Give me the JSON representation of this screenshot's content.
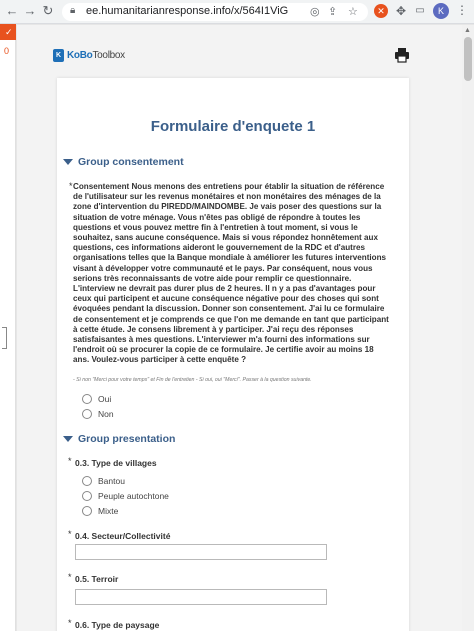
{
  "browser": {
    "url": "ee.humanitarianresponse.info/x/564I1ViG",
    "profile_initial": "K"
  },
  "sidebar": {
    "count": "0"
  },
  "logo": {
    "mark": "K",
    "brand_bold": "KoBo",
    "brand_light": "Toolbox"
  },
  "form": {
    "title": "Formulaire d'enquete 1",
    "groups": [
      {
        "label": "Group consentement"
      },
      {
        "label": "Group presentation"
      }
    ],
    "consent": {
      "required": "*",
      "text": "Consentement Nous menons des entretiens pour établir la situation de référence de l'utilisateur sur les revenus monétaires et non monétaires des ménages de la zone d'intervention du PIREDD/MAINDOMBE. Je vais poser des questions sur la situation de votre ménage. Vous n'êtes pas obligé de répondre à toutes les questions et vous pouvez mettre fin à l'entretien à tout moment, si vous le souhaitez, sans aucune conséquence. Mais si vous répondez honnêtement aux questions, ces informations aideront le gouvernement de la RDC et d'autres organisations telles que la Banque mondiale à améliorer les futures interventions visant à développer votre communauté et le pays. Par conséquent, nous vous serions très reconnaissants de votre aide pour remplir ce questionnaire. L'interview ne devrait pas durer plus de 2 heures. Il n y a pas d'avantages pour ceux qui participent et aucune conséquence négative pour des choses qui sont évoquées pendant la discussion. Donner son consentement. J'ai lu ce formulaire de consentement et je comprends ce que l'on me demande en tant que participant à cette étude. Je consens librement à y participer. J'ai reçu des réponses satisfaisantes à mes questions. L'interviewer m'a fourni des informations sur l'endroit où se procurer la copie de ce formulaire. Je certifie avoir au moins 18 ans. Voulez-vous participer à cette enquête ?",
      "hint": "- Si non \"Merci pour votre temps\" et Fin de l'entretien - Si oui, oui \"Merci\". Passer à la question suivante.",
      "options": [
        "Oui",
        "Non"
      ]
    },
    "q03": {
      "required": "*",
      "label": "0.3. Type de villages",
      "options": [
        "Bantou",
        "Peuple autochtone",
        "Mixte"
      ]
    },
    "q04": {
      "required": "*",
      "label": "0.4. Secteur/Collectivité",
      "value": ""
    },
    "q05": {
      "required": "*",
      "label": "0.5. Terroir",
      "value": ""
    },
    "q06": {
      "required": "*",
      "label": "0.6. Type de paysage"
    }
  },
  "colors": {
    "accent": "#3b5f8a",
    "brand": "#1e6fb7",
    "extension_orange": "#e8521e"
  },
  "icons": [
    "back-icon",
    "forward-icon",
    "reload-icon",
    "lock-icon",
    "location-icon",
    "share-icon",
    "star-icon",
    "puzzle-icon",
    "print-icon",
    "kebab-icon"
  ]
}
